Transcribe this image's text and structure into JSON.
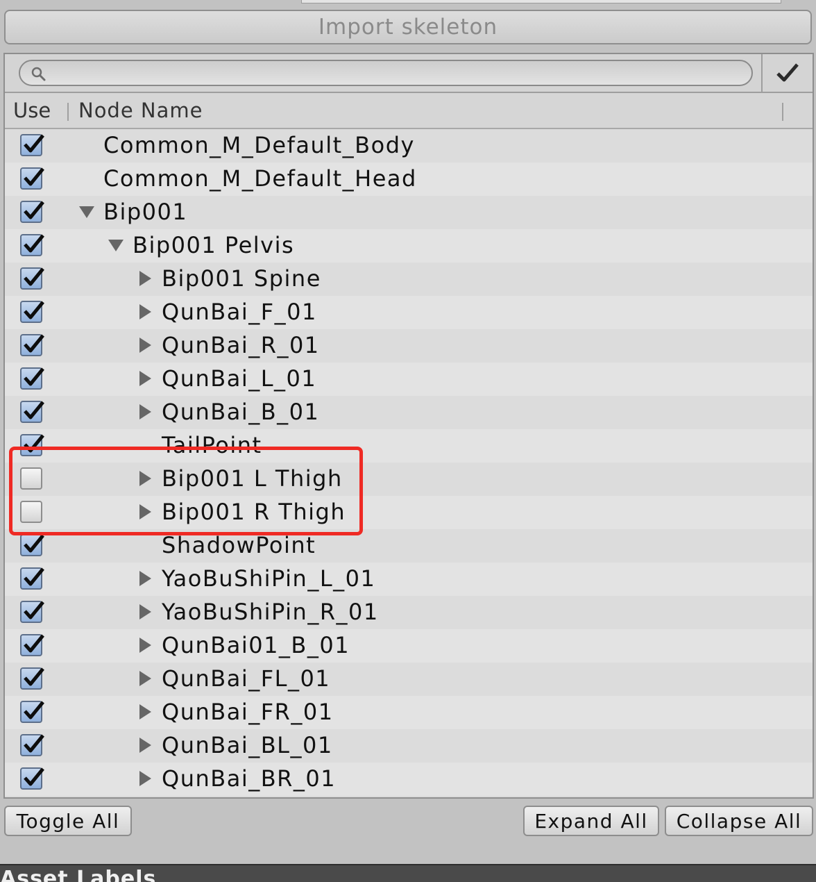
{
  "import_button": {
    "label": "Import skeleton"
  },
  "search": {
    "placeholder": "",
    "value": ""
  },
  "columns": {
    "use": "Use",
    "node_name": "Node Name"
  },
  "nodes": [
    {
      "name": "Common_M_Default_Body",
      "checked": true,
      "depth": 0,
      "expander": "none"
    },
    {
      "name": "Common_M_Default_Head",
      "checked": true,
      "depth": 0,
      "expander": "none"
    },
    {
      "name": "Bip001",
      "checked": true,
      "depth": 0,
      "expander": "expanded"
    },
    {
      "name": "Bip001 Pelvis",
      "checked": true,
      "depth": 1,
      "expander": "expanded"
    },
    {
      "name": "Bip001 Spine",
      "checked": true,
      "depth": 2,
      "expander": "collapsed"
    },
    {
      "name": "QunBai_F_01",
      "checked": true,
      "depth": 2,
      "expander": "collapsed"
    },
    {
      "name": "QunBai_R_01",
      "checked": true,
      "depth": 2,
      "expander": "collapsed"
    },
    {
      "name": "QunBai_L_01",
      "checked": true,
      "depth": 2,
      "expander": "collapsed"
    },
    {
      "name": "QunBai_B_01",
      "checked": true,
      "depth": 2,
      "expander": "collapsed"
    },
    {
      "name": "TailPoint",
      "checked": true,
      "depth": 2,
      "expander": "none"
    },
    {
      "name": "Bip001 L Thigh",
      "checked": false,
      "depth": 2,
      "expander": "collapsed"
    },
    {
      "name": "Bip001 R Thigh",
      "checked": false,
      "depth": 2,
      "expander": "collapsed"
    },
    {
      "name": "ShadowPoint",
      "checked": true,
      "depth": 2,
      "expander": "none"
    },
    {
      "name": "YaoBuShiPin_L_01",
      "checked": true,
      "depth": 2,
      "expander": "collapsed"
    },
    {
      "name": "YaoBuShiPin_R_01",
      "checked": true,
      "depth": 2,
      "expander": "collapsed"
    },
    {
      "name": "QunBai01_B_01",
      "checked": true,
      "depth": 2,
      "expander": "collapsed"
    },
    {
      "name": "QunBai_FL_01",
      "checked": true,
      "depth": 2,
      "expander": "collapsed"
    },
    {
      "name": "QunBai_FR_01",
      "checked": true,
      "depth": 2,
      "expander": "collapsed"
    },
    {
      "name": "QunBai_BL_01",
      "checked": true,
      "depth": 2,
      "expander": "collapsed"
    },
    {
      "name": "QunBai_BR_01",
      "checked": true,
      "depth": 2,
      "expander": "collapsed"
    }
  ],
  "footer_buttons": {
    "toggle_all": "Toggle All",
    "expand_all": "Expand All",
    "collapse_all": "Collapse All"
  },
  "bottom_bar": {
    "label": "Asset Labels"
  },
  "colors": {
    "highlight": "#ef2a24",
    "checkbox_checked": "#8fb0dc",
    "panel_bg": "#dcdcdc"
  },
  "icons": {
    "search": "search-icon",
    "confirm": "checkmark-icon",
    "expanded": "triangle-down-icon",
    "collapsed": "triangle-right-icon"
  }
}
